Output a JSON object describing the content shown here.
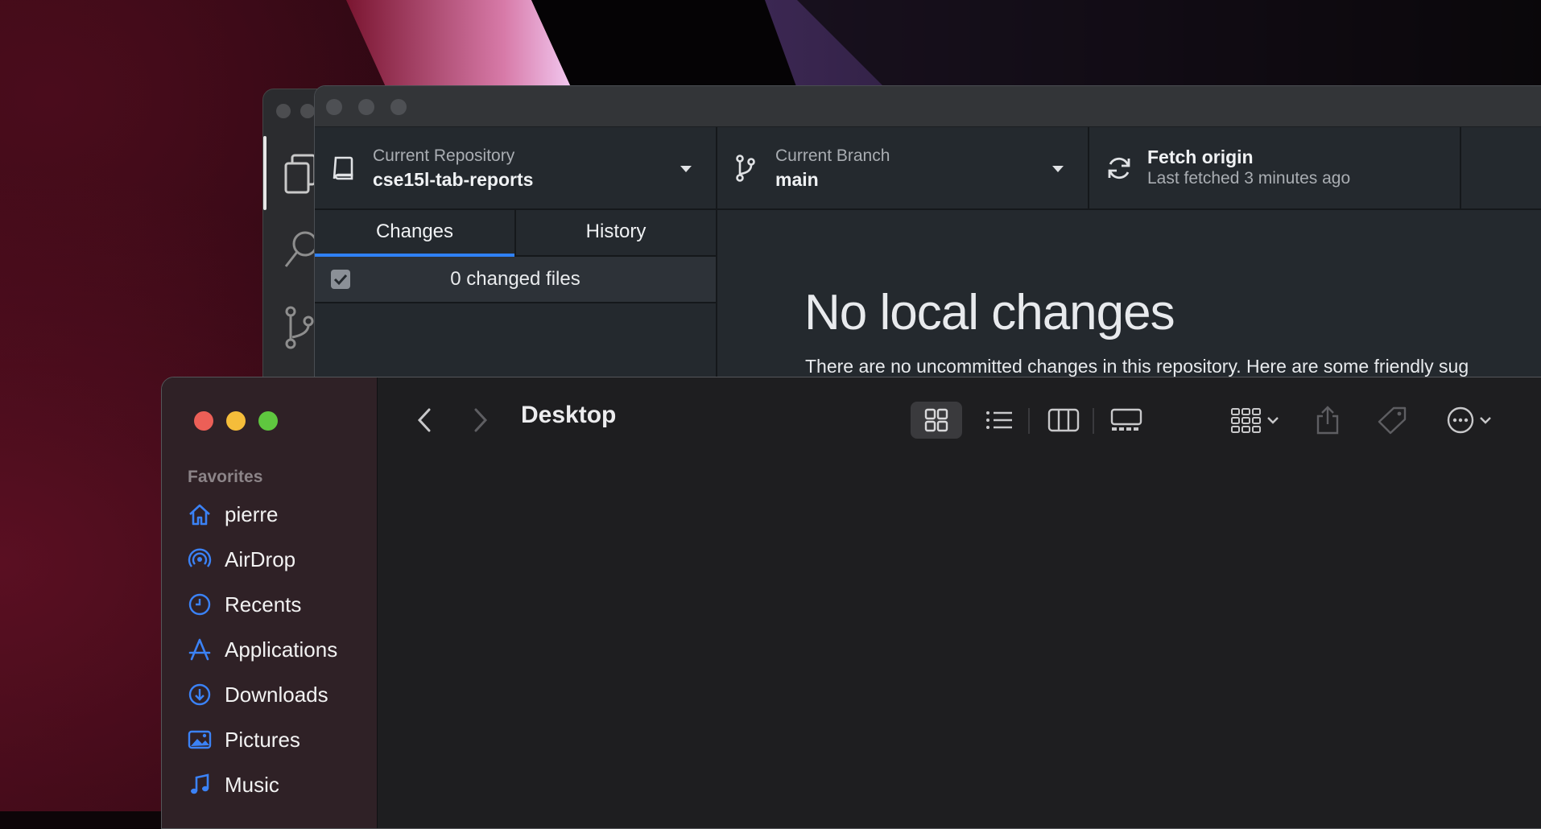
{
  "colors": {
    "accent_blue": "#2f81f7",
    "finder_icon_blue": "#3b82f6",
    "traffic_red": "#ec5f57",
    "traffic_yellow": "#f5bd3a",
    "traffic_green": "#5fc73f"
  },
  "github": {
    "repo": {
      "caption": "Current Repository",
      "name": "cse15l-tab-reports"
    },
    "branch": {
      "caption": "Current Branch",
      "name": "main"
    },
    "fetch": {
      "title": "Fetch origin",
      "subtitle": "Last fetched 3 minutes ago"
    },
    "tabs": [
      {
        "label": "Changes",
        "active": true
      },
      {
        "label": "History",
        "active": false
      }
    ],
    "changed_files": "0 changed files",
    "empty": {
      "headline": "No local changes",
      "description": "There are no uncommitted changes in this repository. Here are some friendly sug"
    }
  },
  "finder": {
    "title": "Desktop",
    "sidebar": {
      "heading": "Favorites",
      "items": [
        {
          "label": "pierre",
          "icon": "home-icon"
        },
        {
          "label": "AirDrop",
          "icon": "airdrop-icon"
        },
        {
          "label": "Recents",
          "icon": "clock-icon"
        },
        {
          "label": "Applications",
          "icon": "applications-icon"
        },
        {
          "label": "Downloads",
          "icon": "download-icon"
        },
        {
          "label": "Pictures",
          "icon": "pictures-icon"
        },
        {
          "label": "Music",
          "icon": "music-icon"
        }
      ]
    },
    "view_modes": [
      "grid-view-icon",
      "list-view-icon",
      "column-view-icon",
      "gallery-view-icon"
    ],
    "selected_view": "grid-view-icon"
  }
}
